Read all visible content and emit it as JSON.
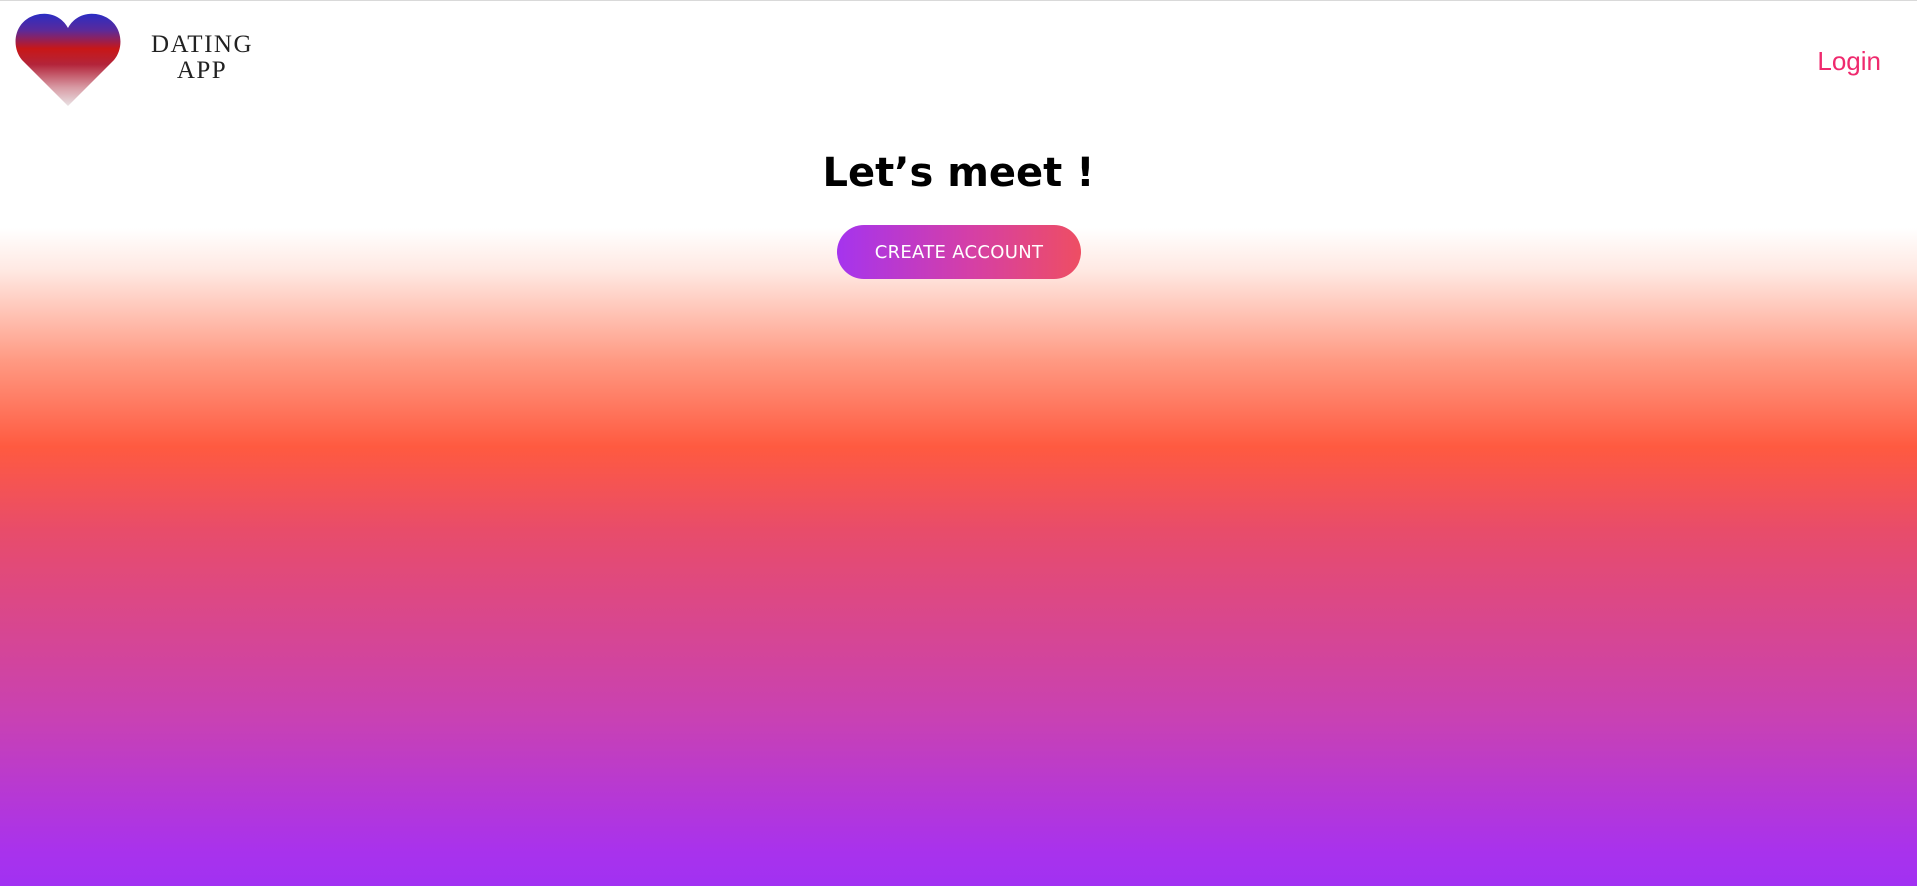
{
  "header": {
    "logo_icon": "heart-icon",
    "brand_line1": "DATING",
    "brand_line2": "APP",
    "login_label": "Login"
  },
  "hero": {
    "title": "Let’s meet !",
    "cta_label": "CREATE ACCOUNT"
  },
  "colors": {
    "accent": "#ef2a6e",
    "gradient_orange": "#ff5a40",
    "gradient_purple": "#a131f2",
    "heart_top": "#2d2cc2",
    "heart_middle": "#c41a1a"
  }
}
